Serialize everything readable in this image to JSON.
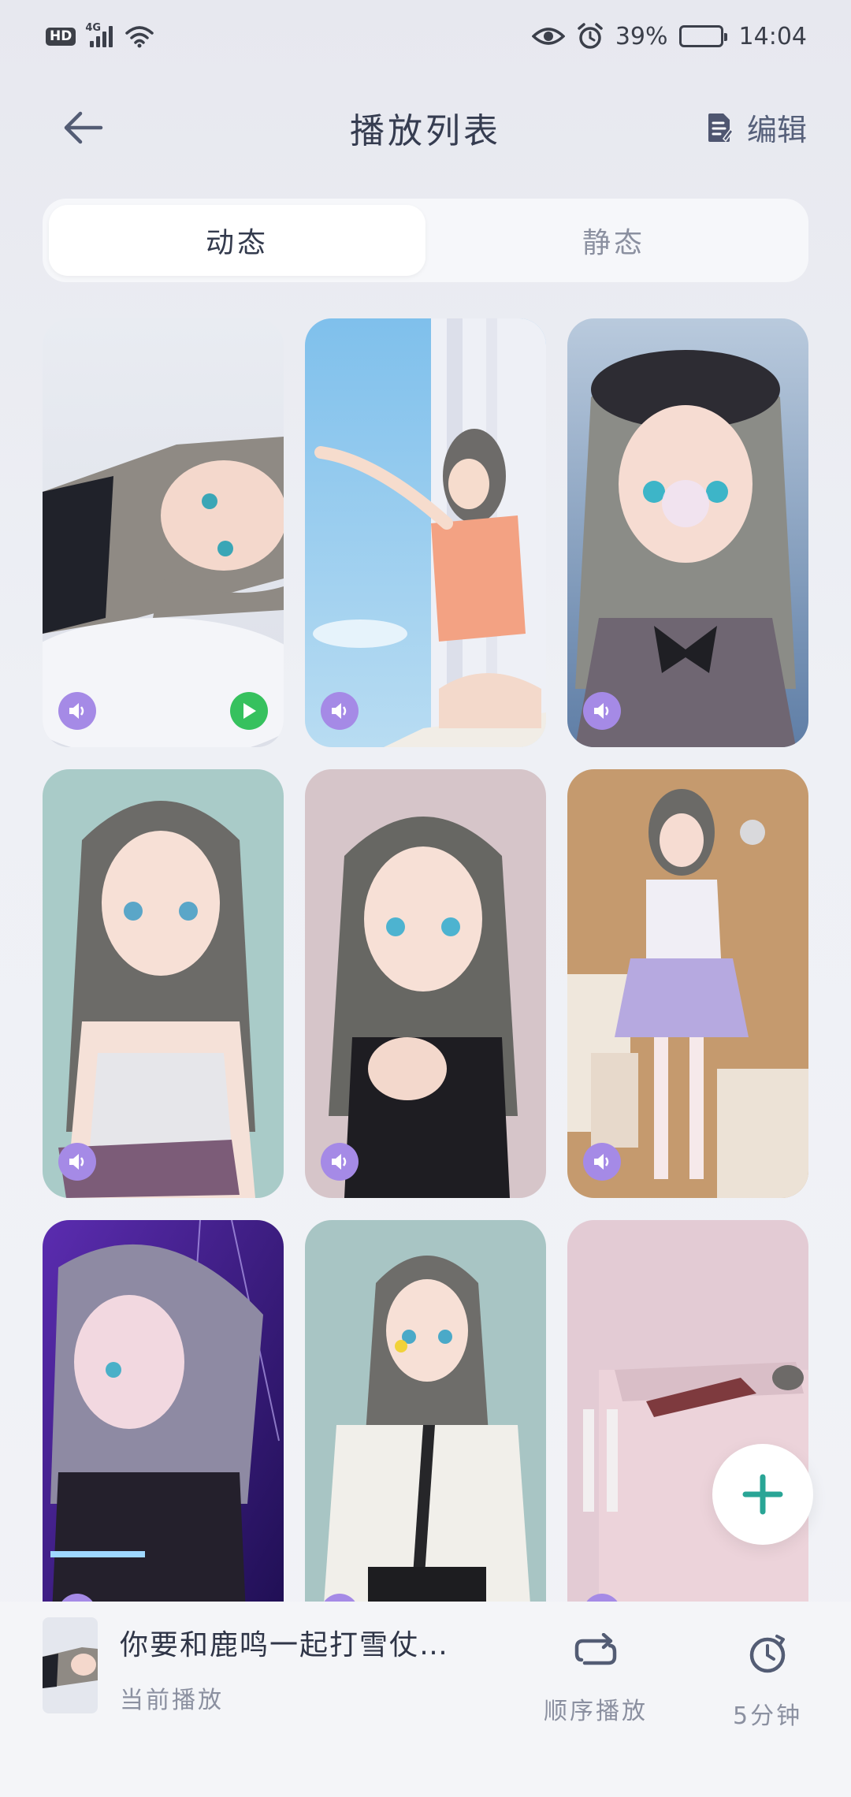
{
  "status_bar": {
    "hd": "HD",
    "network": "4G",
    "battery_percent": "39%",
    "battery_level": 0.39,
    "time": "14:04",
    "icons": [
      "hd-icon",
      "signal-icon",
      "wifi-icon",
      "eye-icon",
      "alarm-icon",
      "battery-icon"
    ]
  },
  "header": {
    "title": "播放列表",
    "edit_label": "编辑",
    "icons": {
      "back": "back-arrow-icon",
      "edit": "edit-document-icon"
    }
  },
  "tabs": [
    {
      "label": "动态",
      "active": true
    },
    {
      "label": "静态",
      "active": false
    }
  ],
  "wallpapers": [
    {
      "id": "snow",
      "has_sound": true,
      "playing": true
    },
    {
      "id": "window",
      "has_sound": true,
      "playing": false
    },
    {
      "id": "bubble",
      "has_sound": true,
      "playing": false
    },
    {
      "id": "book",
      "has_sound": true,
      "playing": false
    },
    {
      "id": "point",
      "has_sound": true,
      "playing": false
    },
    {
      "id": "gifts",
      "has_sound": true,
      "playing": false
    },
    {
      "id": "neon",
      "has_sound": true,
      "playing": false
    },
    {
      "id": "lollipop",
      "has_sound": true,
      "playing": false
    },
    {
      "id": "pink-box",
      "has_sound": true,
      "playing": false
    }
  ],
  "fab": {
    "icon": "plus-icon"
  },
  "now_playing": {
    "title": "你要和鹿鸣一起打雪仗…",
    "subtitle": "当前播放"
  },
  "controls": {
    "order_label": "顺序播放",
    "timer_label": "5分钟",
    "icons": {
      "order": "repeat-icon",
      "timer": "timer-icon"
    }
  },
  "colors": {
    "accent": "#29a596",
    "sound_badge": "#a58ae6",
    "play_badge": "#36c15e",
    "title_text": "#353c50",
    "muted_text": "#8b90a0"
  }
}
